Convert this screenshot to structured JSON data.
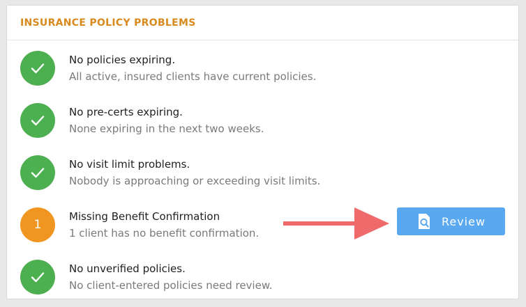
{
  "panel": {
    "title": "INSURANCE POLICY PROBLEMS"
  },
  "rows": [
    {
      "status": "ok",
      "icon": "checkmark-icon",
      "title": "No policies expiring.",
      "subtitle": "All active, insured clients have current policies."
    },
    {
      "status": "ok",
      "icon": "checkmark-icon",
      "title": "No pre-certs expiring.",
      "subtitle": "None expiring in the next two weeks."
    },
    {
      "status": "ok",
      "icon": "checkmark-icon",
      "title": "No visit limit problems.",
      "subtitle": "Nobody is approaching or exceeding visit limits."
    },
    {
      "status": "warning",
      "count": "1",
      "title": "Missing Benefit Confirmation",
      "subtitle": "1 client has no benefit confirmation."
    },
    {
      "status": "ok",
      "icon": "checkmark-icon",
      "title": "No unverified policies.",
      "subtitle": "No client-entered policies need review."
    }
  ],
  "review_button": {
    "label": "Review",
    "icon": "document-search-icon"
  },
  "colors": {
    "ok": "#4caf50",
    "warning": "#f0951f",
    "header_accent": "#d98a1f",
    "button": "#5aa9f0",
    "arrow": "#ef6a6a"
  }
}
